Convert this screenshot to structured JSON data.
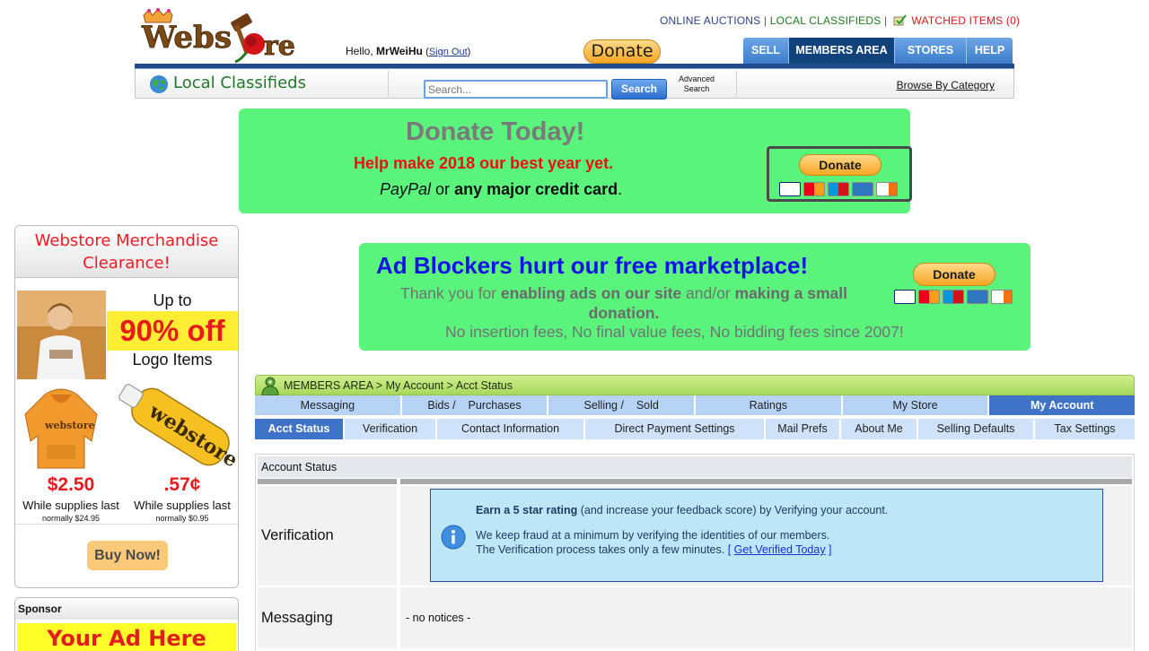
{
  "header": {
    "logo_text": "Webstore",
    "hello_prefix": "Hello,",
    "username": "MrWeiHu",
    "sign_out": "Sign Out",
    "top_links": {
      "online_auctions": "ONLINE AUCTIONS",
      "separator": "|",
      "local_classifieds": "LOCAL CLASSIFIEDS",
      "watched_items": "WATCHED ITEMS (0)"
    },
    "donate_label": "Donate",
    "nav": {
      "sell": "SELL",
      "members_area": "MEMBERS AREA",
      "stores": "STORES",
      "help": "HELP"
    }
  },
  "searchbar": {
    "title": "Local Classifieds",
    "placeholder": "Search...",
    "search_button": "Search",
    "advanced_line1": "Advanced",
    "advanced_line2": "Search",
    "browse_by_category": "Browse By Category"
  },
  "donate_banner": {
    "title": "Donate Today!",
    "subtitle": "Help make 2018 our best year yet.",
    "paypal": "PayPal",
    "or": " or ",
    "any_card": "any major credit card",
    "period": ".",
    "button": "Donate"
  },
  "adblock_banner": {
    "title": "Ad Blockers hurt our free marketplace!",
    "body_1": "Thank you for ",
    "body_2": "enabling ads on our site",
    "body_3": " and/or ",
    "body_4": "making a small donation.",
    "fees": "No insertion fees, No final value fees, No bidding fees since 2007!",
    "button": "Donate"
  },
  "merch": {
    "title_line1": "Webstore Merchandise",
    "title_line2": "Clearance!",
    "up_to": "Up to",
    "discount": "90% off",
    "logo_items": "Logo Items",
    "price_1": "$2.50",
    "price_2": ".57¢",
    "while_supplies_1": "While supplies last",
    "while_supplies_2": "While supplies last",
    "normally_1": "normally $24.95",
    "normally_2": "normally $0.95",
    "buy_now": "Buy Now!"
  },
  "sponsor": {
    "label": "Sponsor",
    "ad_text": "Your Ad Here"
  },
  "members": {
    "breadcrumb": "MEMBERS AREA > My Account > Acct Status",
    "tabs1": [
      "Messaging",
      "Bids /    Purchases",
      "Selling /    Sold",
      "Ratings",
      "My Store",
      "My Account"
    ],
    "tabs2": [
      "Acct Status",
      "Verification",
      "Contact Information",
      "Direct Payment Settings",
      "Mail Prefs",
      "About Me",
      "Selling Defaults",
      "Tax Settings"
    ]
  },
  "account_status": {
    "header": "Account Status",
    "verification_label": "Verification",
    "earn_bold": "Earn a 5 star rating",
    "earn_rest": " (and increase your feedback score) by Verifying your account.",
    "keep_fraud": "We keep fraud at a minimum by verifying the identities of our members.",
    "process_text": "The Verification process takes only a few minutes. ",
    "bracket_open": "[ ",
    "get_verified": "Get Verified Today",
    "bracket_close": " ]",
    "messaging_label": "Messaging",
    "no_notices": "- no notices -"
  },
  "colors": {
    "banner_green": "#5af47c",
    "nav_blue": "#3c7ccc",
    "nav_active": "#12427c",
    "tab_active": "#3e73c8",
    "members_green": "#a6d85b",
    "info_box": "#bde6f6"
  }
}
